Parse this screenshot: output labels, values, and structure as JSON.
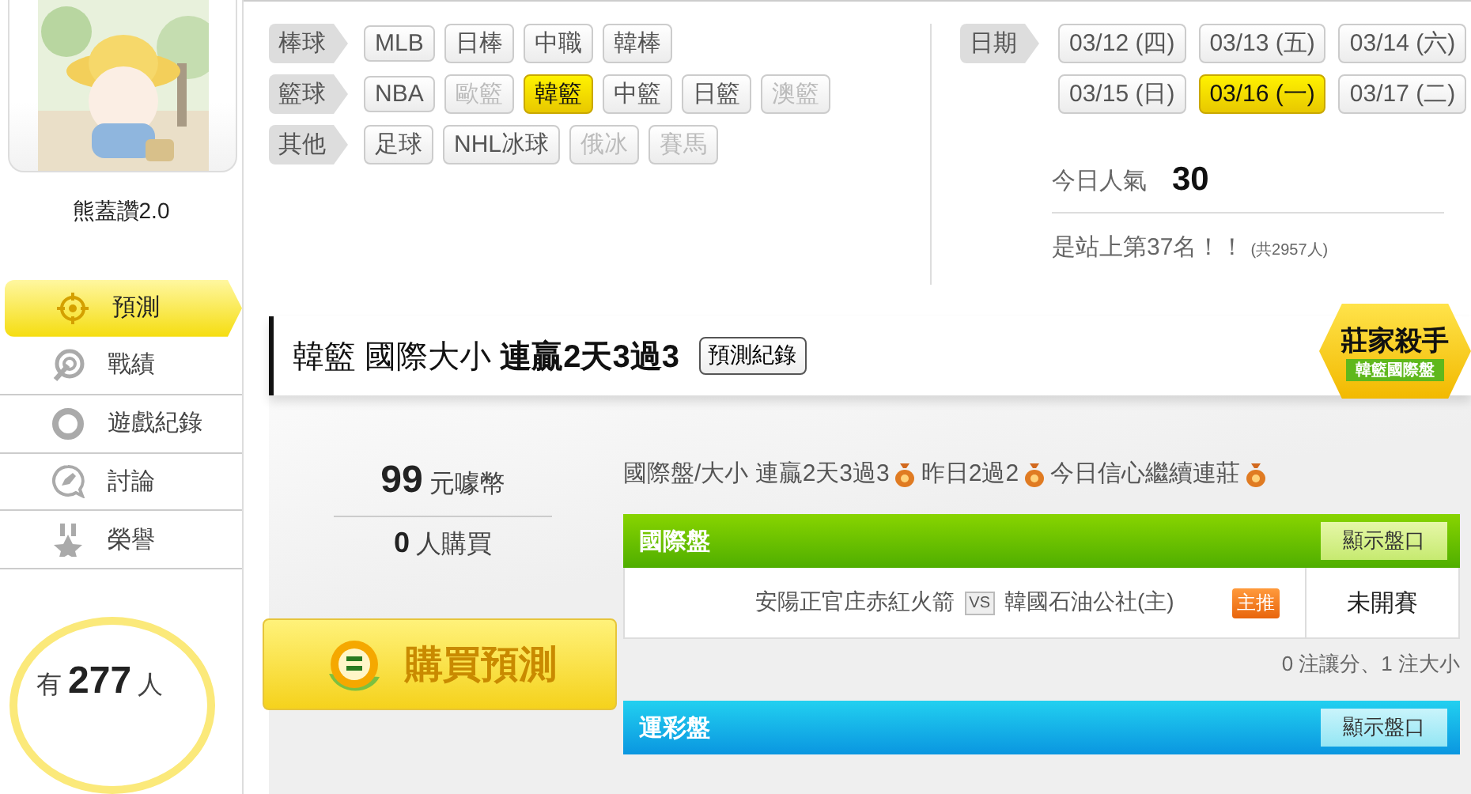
{
  "profile": {
    "name": "熊蓋讚2.0"
  },
  "nav": [
    {
      "label": "預測",
      "kind": "predict",
      "selected": true
    },
    {
      "label": "戰績",
      "kind": "results",
      "selected": false
    },
    {
      "label": "遊戲紀錄",
      "kind": "history",
      "selected": false
    },
    {
      "label": "討論",
      "kind": "forum",
      "selected": false
    },
    {
      "label": "榮譽",
      "kind": "honor",
      "selected": false
    }
  ],
  "followers": {
    "prefix": "有",
    "count": "277",
    "suffix": "人"
  },
  "sport_filters": [
    {
      "category": "棒球",
      "options": [
        {
          "label": "MLB",
          "selected": false,
          "disabled": false
        },
        {
          "label": "日棒",
          "selected": false,
          "disabled": false
        },
        {
          "label": "中職",
          "selected": false,
          "disabled": false
        },
        {
          "label": "韓棒",
          "selected": false,
          "disabled": false
        }
      ]
    },
    {
      "category": "籃球",
      "options": [
        {
          "label": "NBA",
          "selected": false,
          "disabled": false
        },
        {
          "label": "歐籃",
          "selected": false,
          "disabled": true
        },
        {
          "label": "韓籃",
          "selected": true,
          "disabled": false
        },
        {
          "label": "中籃",
          "selected": false,
          "disabled": false
        },
        {
          "label": "日籃",
          "selected": false,
          "disabled": false
        },
        {
          "label": "澳籃",
          "selected": false,
          "disabled": true
        }
      ]
    },
    {
      "category": "其他",
      "options": [
        {
          "label": "足球",
          "selected": false,
          "disabled": false
        },
        {
          "label": "NHL冰球",
          "selected": false,
          "disabled": false
        },
        {
          "label": "俄冰",
          "selected": false,
          "disabled": true
        },
        {
          "label": "賽馬",
          "selected": false,
          "disabled": true
        }
      ]
    }
  ],
  "date_filter": {
    "label": "日期",
    "options": [
      {
        "label": "03/12 (四)",
        "selected": false
      },
      {
        "label": "03/13 (五)",
        "selected": false
      },
      {
        "label": "03/14 (六)",
        "selected": false
      },
      {
        "label": "03/15 (日)",
        "selected": false
      },
      {
        "label": "03/16 (一)",
        "selected": true
      },
      {
        "label": "03/17 (二)",
        "selected": false
      }
    ]
  },
  "popularity": {
    "label": "今日人氣",
    "value": "30",
    "rank": "是站上第37名！！",
    "total": "(共2957人)"
  },
  "prediction": {
    "title": "韓籃 國際大小",
    "streak": "連贏2天3過3",
    "record_button": "預測紀錄",
    "badge": {
      "title": "莊家殺手",
      "subtitle": "韓籃國際盤"
    },
    "price": "99",
    "price_unit": "元噱幣",
    "buyers": "0",
    "buyers_unit": "人購買",
    "buy_button": "購買預測",
    "summary": [
      "國際盤/大小 連贏2天3過3",
      "昨日2過2",
      "今日信心繼續連莊"
    ],
    "markets": [
      {
        "kind": "international",
        "title": "國際盤",
        "button": "顯示盤口",
        "games": [
          {
            "away": "安陽正官庄赤紅火箭",
            "vs": "VS",
            "home": "韓國石油公社(主)",
            "tag": "主推",
            "status": "未開賽"
          }
        ],
        "note": "0 注讓分、1 注大小"
      },
      {
        "kind": "lottery",
        "title": "運彩盤",
        "button": "顯示盤口"
      }
    ]
  }
}
